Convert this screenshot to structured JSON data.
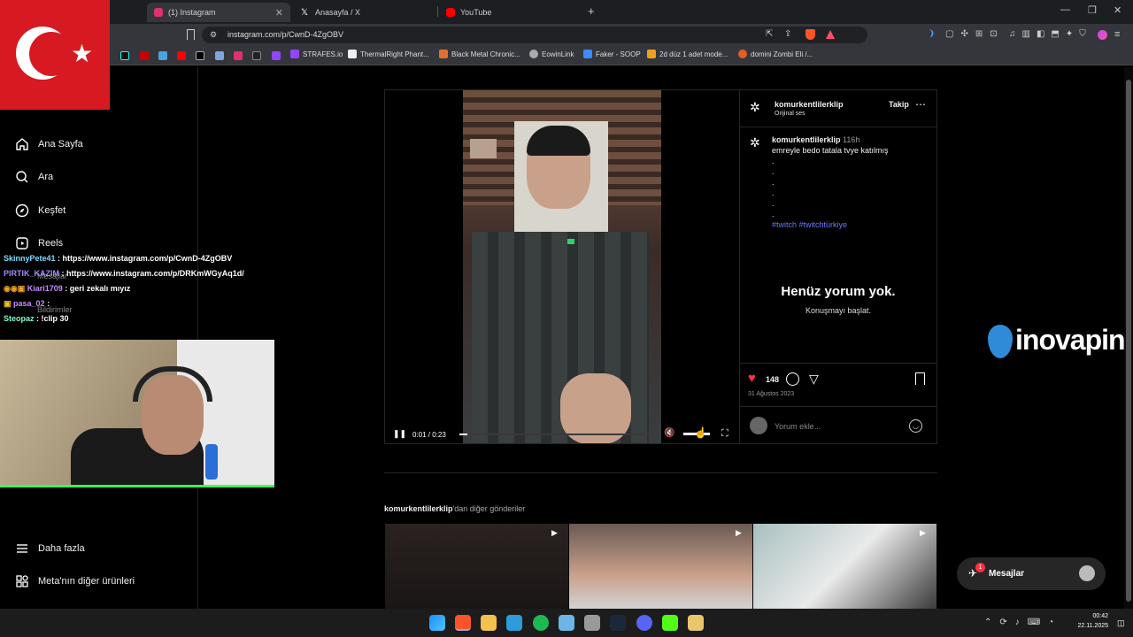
{
  "browser": {
    "tabs": [
      {
        "label": "(1) Instagram",
        "color": "#e1306c"
      },
      {
        "label": "Anasayfa / X",
        "color": "#ffffff"
      },
      {
        "label": "YouTube",
        "color": "#ff0000"
      }
    ],
    "url": "instagram.com/p/CwnD-4ZgOBV",
    "bookmarks": [
      "STRAFES.io",
      "ThermalRight Phant...",
      "Black Metal Chronic...",
      "EowinLink",
      "Faker - SOOP",
      "2d düz 1 adet mode...",
      "domini Zombi Eli /..."
    ]
  },
  "sidebar": {
    "items": [
      {
        "label": "Ana Sayfa",
        "icon": "home-icon"
      },
      {
        "label": "Ara",
        "icon": "search-icon"
      },
      {
        "label": "Keşfet",
        "icon": "compass-icon"
      },
      {
        "label": "Reels",
        "icon": "reels-icon"
      }
    ],
    "overlap": [
      "Mesajlar",
      "Bildirimler"
    ],
    "bottom": [
      {
        "label": "Daha fazla",
        "icon": "menu-icon"
      },
      {
        "label": "Meta'nın diğer ürünleri",
        "icon": "meta-icon"
      }
    ]
  },
  "chat": [
    {
      "user": "SkinnyPete41",
      "text": ": https://www.instagram.com/p/CwnD-4ZgOBV",
      "color": "#7cdbff"
    },
    {
      "user": "PIRTIK_KAZIM",
      "text": ": https://www.instagram.com/p/DRKmWGyAq1d/",
      "color": "#9f8cff"
    },
    {
      "user": "Kiari1709",
      "text": ": geri zekalı mıyız",
      "color": "#c58cff"
    },
    {
      "user": "pasa_02",
      "text": ":",
      "color": "#c58cff"
    },
    {
      "user": "Steopaz",
      "text": ": !clip 30",
      "color": "#7cffc8"
    }
  ],
  "post": {
    "author": "komurkentlilerklip",
    "audio": "Orijinal ses",
    "follow": "Takip",
    "age": "116h",
    "caption": "emreyle bedo tatala tvye katılmış",
    "dots": [
      ".",
      ".",
      ".",
      ".",
      ".",
      "."
    ],
    "tags": "#twitch #twitchtürkiye",
    "no_comments": "Henüz yorum yok.",
    "start_conv": "Konuşmayı başlat.",
    "likes": "148",
    "date": "31 Ağustos 2023",
    "comment_placeholder": "Yorum ekle...",
    "time": "0:01 / 0:23",
    "progress": 0.043
  },
  "more_from": {
    "user": "komurkentlilerklip",
    "suffix": "'dan diğer gönderiler"
  },
  "brand": "inovapin",
  "messages": {
    "label": "Mesajlar",
    "badge": "1"
  },
  "clock": {
    "time": "00:42",
    "date": "22.11.2025"
  },
  "colors": {
    "like": "#ff3040",
    "link": "#4e5fe6",
    "accent": "#3cff5c"
  }
}
